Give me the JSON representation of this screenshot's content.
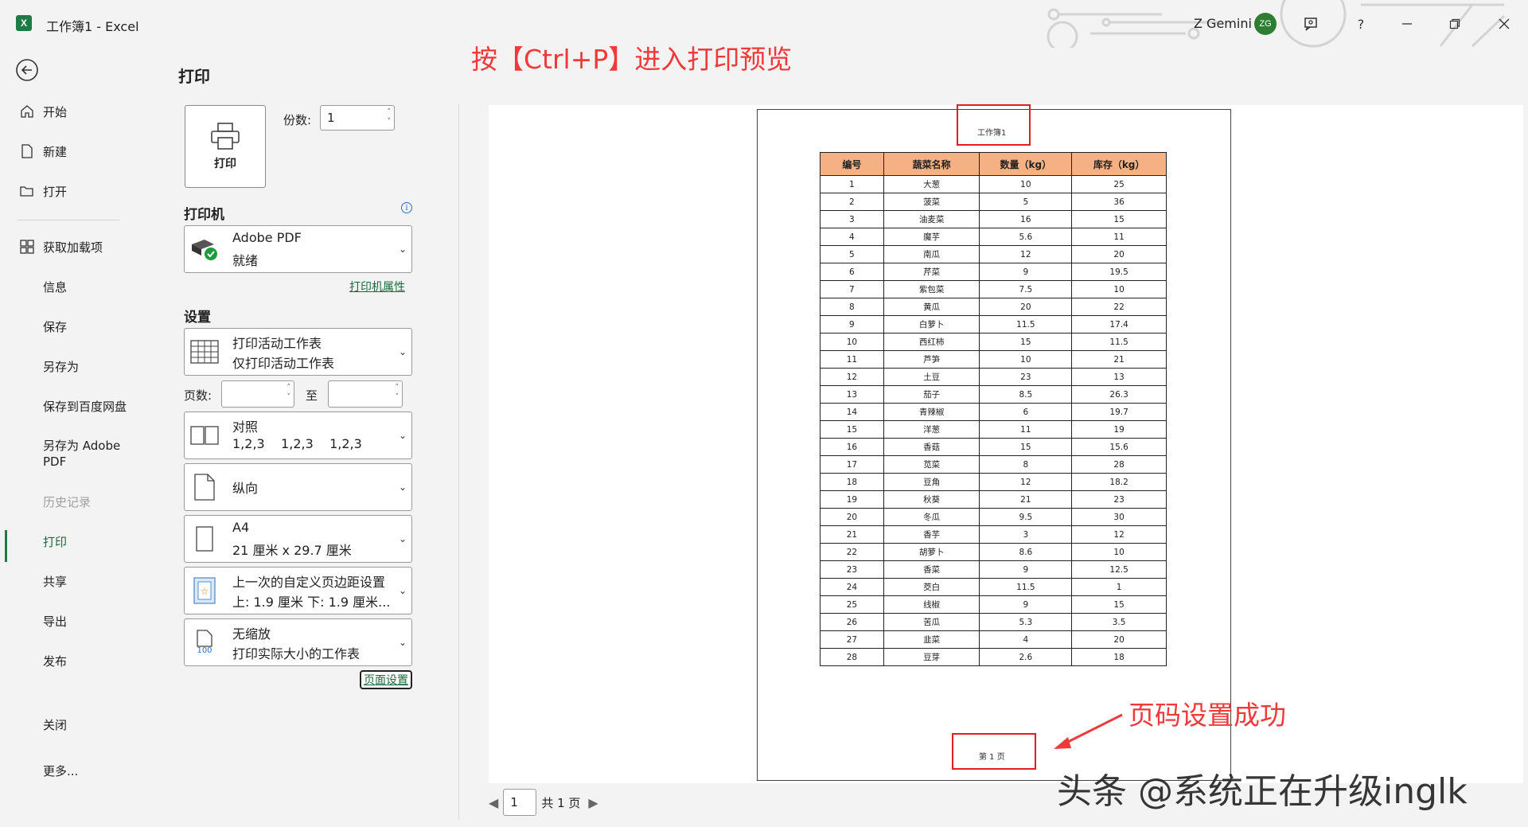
{
  "window": {
    "title": "工作簿1 - Excel",
    "app_icon": "X",
    "user_name": "Z Gemini",
    "user_initials": "ZG",
    "help": "?",
    "controls": [
      "minimize-icon",
      "restore-icon",
      "close-icon"
    ]
  },
  "nav": {
    "items": [
      {
        "label": "开始",
        "icon": "home-icon"
      },
      {
        "label": "新建",
        "icon": "new-file-icon"
      },
      {
        "label": "打开",
        "icon": "folder-icon"
      },
      {
        "label": "获取加载项",
        "icon": "addins-icon"
      },
      {
        "label": "信息"
      },
      {
        "label": "保存"
      },
      {
        "label": "另存为"
      },
      {
        "label": "保存到百度网盘"
      },
      {
        "label": "另存为 Adobe PDF"
      },
      {
        "label": "历史记录",
        "disabled": true
      },
      {
        "label": "打印",
        "active": true
      },
      {
        "label": "共享"
      },
      {
        "label": "导出"
      },
      {
        "label": "发布"
      },
      {
        "label": "关闭"
      },
      {
        "label": "更多..."
      }
    ]
  },
  "print": {
    "heading": "打印",
    "print_button": "打印",
    "copies_label": "份数:",
    "copies_value": "1",
    "printer_heading": "打印机",
    "printer_name": "Adobe PDF",
    "printer_status": "就绪",
    "printer_props": "打印机属性",
    "settings_heading": "设置",
    "what": {
      "l1": "打印活动工作表",
      "l2": "仅打印活动工作表"
    },
    "pages_label": "页数:",
    "pages_to": "至",
    "collate": {
      "l1": "对照",
      "l2": "1,2,3    1,2,3    1,2,3"
    },
    "orientation": "纵向",
    "paper": {
      "l1": "A4",
      "l2": "21 厘米 x 29.7 厘米"
    },
    "margins": {
      "l1": "上一次的自定义页边距设置",
      "l2": "上: 1.9 厘米 下: 1.9 厘米..."
    },
    "scaling": {
      "l1": "无缩放",
      "l2": "打印实际大小的工作表",
      "icon_text": "100"
    },
    "page_setup": "页面设置"
  },
  "preview": {
    "header": "工作簿1",
    "footer": "第 1 页",
    "columns": [
      "编号",
      "蔬菜名称",
      "数量（kg）",
      "库存（kg）"
    ],
    "rows": [
      [
        "1",
        "大葱",
        "10",
        "25"
      ],
      [
        "2",
        "菠菜",
        "5",
        "36"
      ],
      [
        "3",
        "油麦菜",
        "16",
        "15"
      ],
      [
        "4",
        "魔芋",
        "5.6",
        "11"
      ],
      [
        "5",
        "南瓜",
        "12",
        "20"
      ],
      [
        "6",
        "芹菜",
        "9",
        "19.5"
      ],
      [
        "7",
        "紫包菜",
        "7.5",
        "10"
      ],
      [
        "8",
        "黄瓜",
        "20",
        "22"
      ],
      [
        "9",
        "白萝卜",
        "11.5",
        "17.4"
      ],
      [
        "10",
        "西红柿",
        "15",
        "11.5"
      ],
      [
        "11",
        "芦笋",
        "10",
        "21"
      ],
      [
        "12",
        "土豆",
        "23",
        "13"
      ],
      [
        "13",
        "茄子",
        "8.5",
        "26.3"
      ],
      [
        "14",
        "青辣椒",
        "6",
        "19.7"
      ],
      [
        "15",
        "洋葱",
        "11",
        "19"
      ],
      [
        "16",
        "香菇",
        "15",
        "15.6"
      ],
      [
        "17",
        "苋菜",
        "8",
        "28"
      ],
      [
        "18",
        "豆角",
        "12",
        "18.2"
      ],
      [
        "19",
        "秋葵",
        "21",
        "23"
      ],
      [
        "20",
        "冬瓜",
        "9.5",
        "30"
      ],
      [
        "21",
        "香芋",
        "3",
        "12"
      ],
      [
        "22",
        "胡萝卜",
        "8.6",
        "10"
      ],
      [
        "23",
        "香菜",
        "9",
        "12.5"
      ],
      [
        "24",
        "茭白",
        "11.5",
        "1"
      ],
      [
        "25",
        "线椒",
        "9",
        "15"
      ],
      [
        "26",
        "苦瓜",
        "5.3",
        "3.5"
      ],
      [
        "27",
        "韭菜",
        "4",
        "20"
      ],
      [
        "28",
        "豆芽",
        "2.6",
        "18"
      ]
    ],
    "page_value": "1",
    "page_total": "共 1 页"
  },
  "annotations": {
    "top": "按【Ctrl+P】进入打印预览",
    "bottom": "页码设置成功",
    "color": "#f03a3a"
  },
  "watermark": "头条 @系统正在升级inglk",
  "colors": {
    "accent": "#1f7a45",
    "table_header": "#f5b183",
    "highlight_box": "#e02020"
  }
}
